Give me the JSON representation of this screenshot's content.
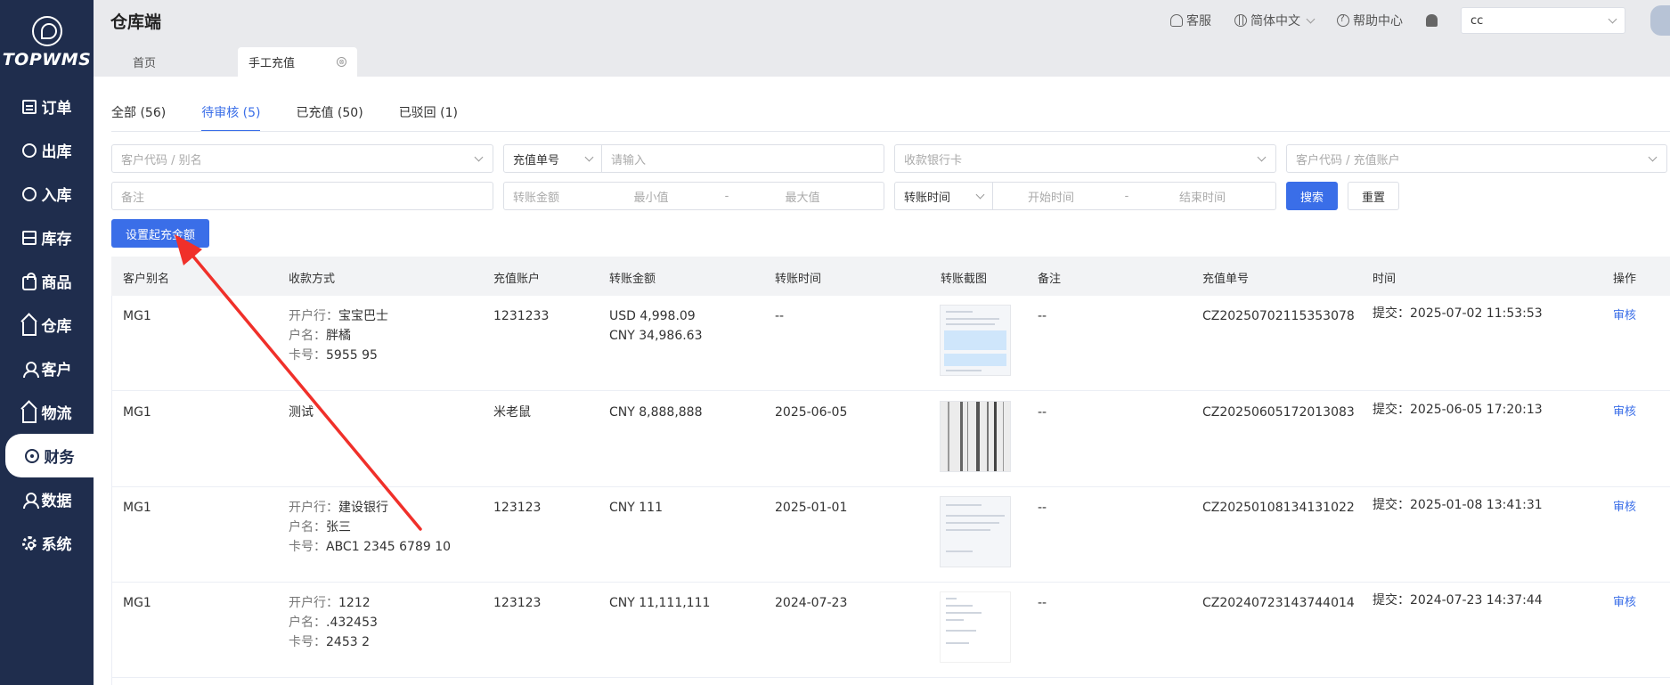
{
  "app": {
    "logo_text": "TOPWMS",
    "title": "仓库端"
  },
  "header": {
    "service": "客服",
    "language": "简体中文",
    "help": "帮助中心",
    "store_value": "cc"
  },
  "sidebar": {
    "items": [
      {
        "label": "订单",
        "icon": "document-icon"
      },
      {
        "label": "出库",
        "icon": "outbound-icon"
      },
      {
        "label": "入库",
        "icon": "inbound-icon"
      },
      {
        "label": "库存",
        "icon": "inventory-icon"
      },
      {
        "label": "商品",
        "icon": "product-bag-icon"
      },
      {
        "label": "仓库",
        "icon": "warehouse-house-icon"
      },
      {
        "label": "客户",
        "icon": "customer-user-icon"
      },
      {
        "label": "物流",
        "icon": "logistics-house-icon"
      },
      {
        "label": "财务",
        "icon": "finance-eye-icon"
      },
      {
        "label": "数据",
        "icon": "data-user-icon"
      },
      {
        "label": "系统",
        "icon": "system-gear-icon"
      }
    ],
    "active_index": 8
  },
  "page_tabs": {
    "home": "首页",
    "current": "手工充值",
    "close": "⊗"
  },
  "status_tabs": [
    "全部 (56)",
    "待审核 (5)",
    "已充值 (50)",
    "已驳回 (1)"
  ],
  "filters": {
    "customer_placeholder": "客户代码 / 别名",
    "recharge_no_label": "充值单号",
    "recharge_no_placeholder": "请输入",
    "bank_card_placeholder": "收款银行卡",
    "customer_account_placeholder": "客户代码 / 充值账户",
    "remark_placeholder": "备注",
    "amount_label": "转账金额",
    "min_placeholder": "最小值",
    "range_sep": "-",
    "max_placeholder": "最大值",
    "time_label": "转账时间",
    "start_placeholder": "开始时间",
    "end_placeholder": "结束时间",
    "search_button": "搜索",
    "reset_button": "重置",
    "set_min_button": "设置起充金额"
  },
  "table": {
    "headers": [
      "客户别名",
      "收款方式",
      "充值账户",
      "转账金额",
      "转账时间",
      "转账截图",
      "备注",
      "充值单号",
      "时间",
      "操作"
    ],
    "labels": {
      "bank": "开户行：",
      "name": "户名：",
      "card": "卡号："
    },
    "rows": [
      {
        "alias": "MG1",
        "bank": "宝宝巴士",
        "holder": "胖橘",
        "card": "5955 95",
        "account": "1231233",
        "amount1": "USD 4,998.09",
        "amount2": "CNY 34,986.63",
        "transfer_time": "--",
        "remark": "--",
        "order_no": "CZ20250702115353078",
        "time": "提交：2025-07-02 11:53:53",
        "action": "审核"
      },
      {
        "alias": "MG1",
        "method_text": "测试",
        "account": "米老鼠",
        "amount1": "CNY 8,888,888",
        "transfer_time": "2025-06-05",
        "remark": "--",
        "order_no": "CZ20250605172013083",
        "time": "提交：2025-06-05 17:20:13",
        "action": "审核"
      },
      {
        "alias": "MG1",
        "bank": "建设银行",
        "holder": "张三",
        "card": "ABC1 2345 6789 10",
        "account": "123123",
        "amount1": "CNY 111",
        "transfer_time": "2025-01-01",
        "remark": "--",
        "order_no": "CZ20250108134131022",
        "time": "提交：2025-01-08 13:41:31",
        "action": "审核"
      },
      {
        "alias": "MG1",
        "bank": "1212",
        "holder": ".432453",
        "card": "2453 2",
        "account": "123123",
        "amount1": "CNY 11,111,111",
        "transfer_time": "2024-07-23",
        "remark": "--",
        "order_no": "CZ20240723143744014",
        "time": "提交：2024-07-23 14:37:44",
        "action": "审核"
      }
    ]
  },
  "colors": {
    "sidebar_bg": "#1f2d4d",
    "accent": "#3a6ee8",
    "annotation_arrow": "#f0302a"
  }
}
